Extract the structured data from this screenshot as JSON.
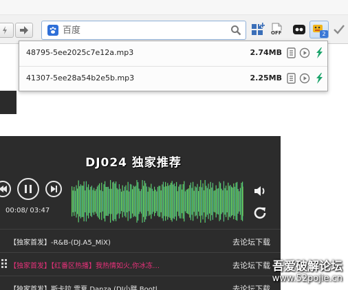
{
  "toolbar": {
    "search": {
      "value": "",
      "placeholder": "百度",
      "engine_icon": "baidu-paw-icon"
    },
    "icons": [
      "back-arrow-icon",
      "forward-arrow-icon",
      "search-icon",
      "apps-grid-icon",
      "office-off-icon",
      "sync-tab-icon",
      "media-sniffer-extension-icon",
      "checkmark-icon"
    ],
    "extension_badge": "2",
    "office_label": "OFF"
  },
  "media_panel": {
    "items": [
      {
        "file_name": "48795-5ee2025c7e12a.mp3",
        "size": "2.74MB"
      },
      {
        "file_name": "41307-5ee28a54b2e5b.mp3",
        "size": "2.25MB"
      }
    ],
    "actions": [
      "copy-link-icon",
      "play-icon",
      "download-icon"
    ]
  },
  "player": {
    "title": "DJ024 独家推荐",
    "time": "00:08/ 03:47"
  },
  "playlist": {
    "rows": [
      {
        "title": "【独家首发】-R&B-(DJ.A5_MiX)",
        "download": "去论坛下载",
        "highlight": false
      },
      {
        "title": "【独家首发】【红番区热播】我热情如火,你冰冻…",
        "download": "去论坛下载",
        "highlight": true
      },
      {
        "title": "【独家首发】斯卡拉 雪夏 Danza (DJ小胖 Bootl…",
        "download": "去论坛下载",
        "highlight": false
      }
    ]
  },
  "watermark": {
    "title": "吾爱破解论坛",
    "url": "www.52pojie.cn"
  },
  "colors": {
    "accent_blue": "#3a78d6",
    "download_green": "#1aa36a",
    "highlight_pink": "#e8317a",
    "player_bg": "#2c2c2c"
  }
}
